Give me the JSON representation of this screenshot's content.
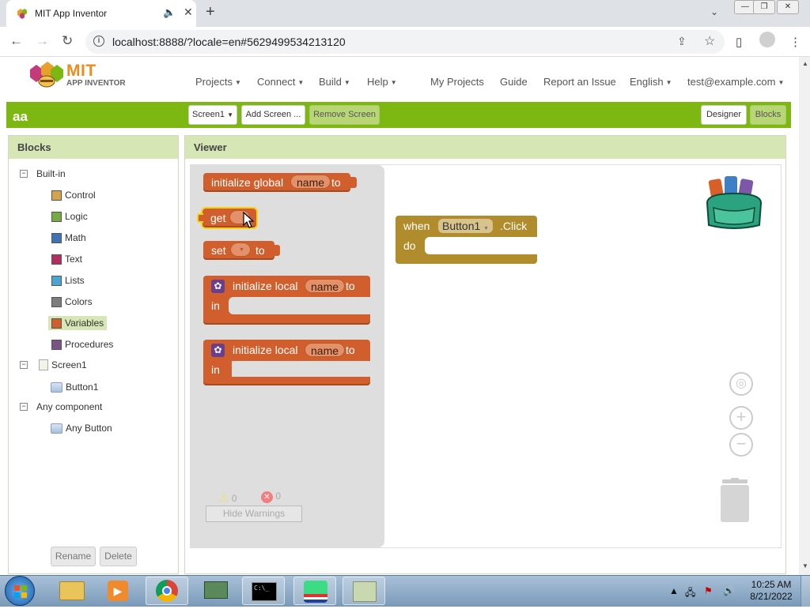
{
  "browser": {
    "tab_title": "MIT App Inventor",
    "url": "localhost:8888/?locale=en#5629499534213120",
    "new_tab": "+",
    "mute": "🔈",
    "close": "✕"
  },
  "header": {
    "logo_text": "MIT",
    "logo_subtext": "APP INVENTOR",
    "menus": [
      {
        "label": "Projects",
        "dropdown": true
      },
      {
        "label": "Connect",
        "dropdown": true
      },
      {
        "label": "Build",
        "dropdown": true
      },
      {
        "label": "Help",
        "dropdown": true
      }
    ],
    "links": [
      "My Projects",
      "Guide",
      "Report an Issue"
    ],
    "language": "English",
    "account": "test@example.com"
  },
  "toolbar": {
    "project_name": "aa",
    "screen_select": "Screen1",
    "add_screen": "Add Screen ...",
    "remove_screen": "Remove Screen",
    "designer": "Designer",
    "blocks": "Blocks"
  },
  "blocks_panel": {
    "title": "Blocks",
    "builtin_label": "Built-in",
    "builtin": [
      {
        "label": "Control",
        "color": "#d6a24a"
      },
      {
        "label": "Logic",
        "color": "#77ab41"
      },
      {
        "label": "Math",
        "color": "#3f71b5"
      },
      {
        "label": "Text",
        "color": "#b32d5e"
      },
      {
        "label": "Lists",
        "color": "#49a6d4"
      },
      {
        "label": "Colors",
        "color": "#7d7d7d"
      },
      {
        "label": "Variables",
        "color": "#d05f2d"
      },
      {
        "label": "Procedures",
        "color": "#7c5385"
      }
    ],
    "screen_label": "Screen1",
    "screen_children": [
      "Button1"
    ],
    "any_component_label": "Any component",
    "any_component_children": [
      "Any Button"
    ],
    "rename": "Rename",
    "delete": "Delete"
  },
  "viewer": {
    "title": "Viewer",
    "flyout": {
      "init_global": {
        "prefix": "initialize global",
        "name": "name",
        "suffix": "to"
      },
      "get": {
        "label": "get"
      },
      "set": {
        "label": "set",
        "suffix": "to"
      },
      "init_local_1": {
        "prefix": "initialize local",
        "name": "name",
        "suffix": "to",
        "in": "in"
      },
      "init_local_2": {
        "prefix": "initialize local",
        "name": "name",
        "suffix": "to",
        "in": "in"
      }
    },
    "event_block": {
      "when": "when",
      "component": "Button1",
      "event": ".Click",
      "do": "do"
    },
    "warnings": {
      "warning_count": "0",
      "error_count": "0",
      "hide_warnings": "Hide Warnings"
    }
  },
  "taskbar": {
    "time": "10:25 AM",
    "date": "8/21/2022"
  }
}
